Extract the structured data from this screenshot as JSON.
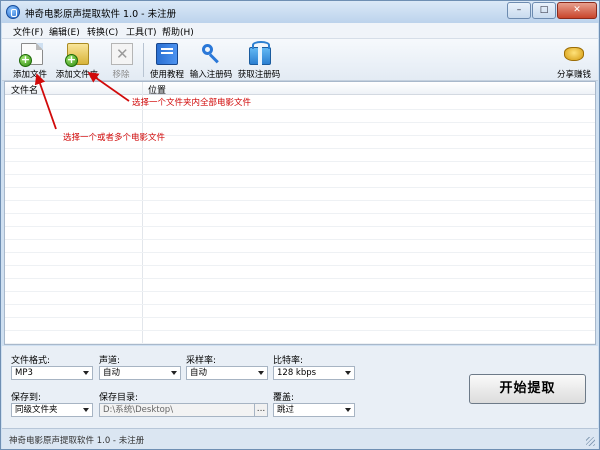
{
  "window": {
    "title": "神奇电影原声提取软件 1.0 - 未注册",
    "controls": {
      "minimize": "–",
      "maximize": "□",
      "close": "✕"
    }
  },
  "menu": [
    {
      "label": "文件(F)"
    },
    {
      "label": "编辑(E)"
    },
    {
      "label": "转换(C)"
    },
    {
      "label": "工具(T)"
    },
    {
      "label": "帮助(H)"
    }
  ],
  "toolbar": {
    "add_file": "添加文件",
    "add_folder": "添加文件夹",
    "remove": "移除",
    "tutorial": "使用教程",
    "enter_code": "输入注册码",
    "get_code": "获取注册码",
    "share": "分享赚钱"
  },
  "file_list": {
    "columns": [
      "文件名",
      "位置"
    ],
    "rows": []
  },
  "annotations": {
    "folder_note": "选择一个文件夹内全部电影文件",
    "file_note": "选择一个或者多个电影文件"
  },
  "settings": {
    "format_label": "文件格式:",
    "format_value": "MP3",
    "channel_label": "声道:",
    "channel_value": "自动",
    "samplerate_label": "采样率:",
    "samplerate_value": "自动",
    "bitrate_label": "比特率:",
    "bitrate_value": "128 kbps",
    "saveto_label": "保存到:",
    "saveto_value": "同级文件夹",
    "dir_label": "保存目录:",
    "dir_value": "D:\\系统\\Desktop\\",
    "browse": "...",
    "overwrite_label": "覆盖:",
    "overwrite_value": "跳过"
  },
  "start_button": "开始提取",
  "status_text": "神奇电影原声提取软件 1.0 - 未注册",
  "colors": {
    "annotation": "#d10a0a",
    "titlebar": "#c9dcf0"
  }
}
